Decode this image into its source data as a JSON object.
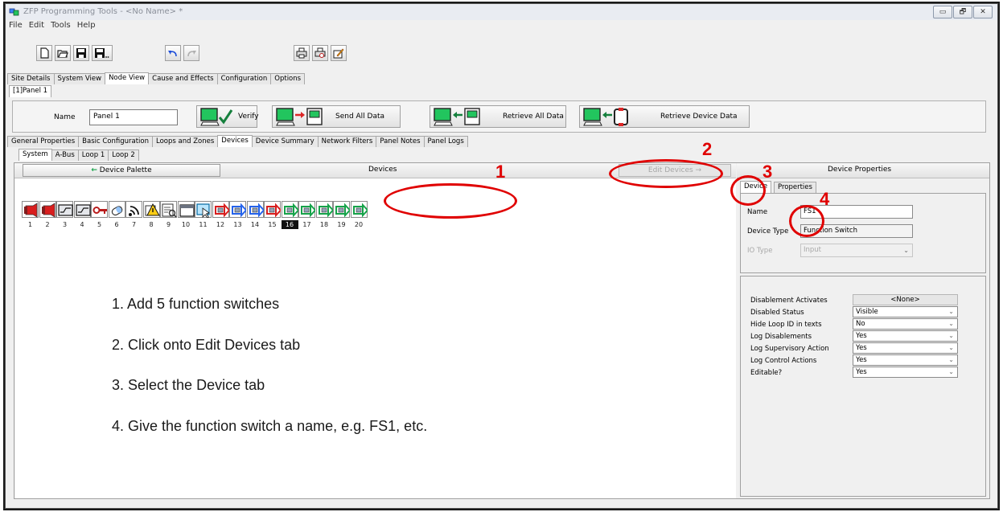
{
  "window": {
    "title": "ZFP Programming Tools - <No Name> *",
    "controls": [
      "▭",
      "🗗",
      "✕"
    ]
  },
  "menu": [
    "File",
    "Edit",
    "Tools",
    "Help"
  ],
  "toolbar_icons": [
    "new-icon",
    "open-icon",
    "save-icon",
    "save-as-icon",
    "undo-icon",
    "redo-icon",
    "print-icon",
    "print-preview-icon",
    "edit-document-icon"
  ],
  "main_tabs": [
    "Site Details",
    "System View",
    "Node View",
    "Cause and Effects",
    "Configuration",
    "Options"
  ],
  "main_tabs_active": "Node View",
  "panel_tab": "[1]Panel 1",
  "panel": {
    "name_label": "Name",
    "name_value": "Panel 1",
    "buttons": [
      "Verify",
      "Send All Data",
      "Retrieve All Data",
      "Retrieve Device Data"
    ]
  },
  "node_tabs": [
    "General Properties",
    "Basic Configuration",
    "Loops and Zones",
    "Devices",
    "Device Summary",
    "Network Filters",
    "Panel Notes",
    "Panel Logs"
  ],
  "node_tabs_active": "Devices",
  "loop_tabs": [
    "System",
    "A-Bus",
    "Loop 1",
    "Loop 2"
  ],
  "loop_tabs_active": "System",
  "devices_header": {
    "palette_label": "Device Palette",
    "center_label": "Devices",
    "edit_label": "Edit Devices",
    "props_label": "Device Properties"
  },
  "devices": [
    {
      "num": "1",
      "kind": "sounder"
    },
    {
      "num": "2",
      "kind": "sounder"
    },
    {
      "num": "3",
      "kind": "relay"
    },
    {
      "num": "4",
      "kind": "relay"
    },
    {
      "num": "5",
      "kind": "key"
    },
    {
      "num": "6",
      "kind": "input"
    },
    {
      "num": "7",
      "kind": "wireless"
    },
    {
      "num": "8",
      "kind": "warning"
    },
    {
      "num": "9",
      "kind": "report"
    },
    {
      "num": "10",
      "kind": "display"
    },
    {
      "num": "11",
      "kind": "pointer"
    },
    {
      "num": "12",
      "kind": "switch-red"
    },
    {
      "num": "13",
      "kind": "switch-blue"
    },
    {
      "num": "14",
      "kind": "switch-blue"
    },
    {
      "num": "15",
      "kind": "switch-red"
    },
    {
      "num": "16",
      "kind": "switch-green"
    },
    {
      "num": "17",
      "kind": "switch-green"
    },
    {
      "num": "18",
      "kind": "switch-green"
    },
    {
      "num": "19",
      "kind": "switch-green"
    },
    {
      "num": "20",
      "kind": "switch-green"
    }
  ],
  "selected_device": "16",
  "colors": {
    "annotation_red": "#e00000",
    "device_red": "#d81e1e",
    "screen_green": "#22c55e"
  },
  "instructions": [
    "1.   Add 5 function switches",
    "2.   Click onto Edit Devices tab",
    "3.   Select the Device tab",
    "4.   Give the function switch a name, e.g. FS1, etc."
  ],
  "annotations": [
    "1",
    "2",
    "3",
    "4"
  ],
  "props": {
    "tabs": [
      "Device",
      "Properties"
    ],
    "active_tab": "Device",
    "name_label": "Name",
    "name_value": "FS1",
    "type_label": "Device Type",
    "type_value": "Function Switch",
    "io_label": "IO Type",
    "io_value": "Input",
    "rows": [
      {
        "label": "Disablement Activates",
        "value": "<None>"
      },
      {
        "label": "Disabled Status",
        "value": "Visible"
      },
      {
        "label": "Hide Loop ID in texts",
        "value": "No"
      },
      {
        "label": "Log Disablements",
        "value": "Yes"
      },
      {
        "label": "Log Supervisory Action",
        "value": "Yes"
      },
      {
        "label": "Log Control Actions",
        "value": "Yes"
      },
      {
        "label": "Editable?",
        "value": "Yes"
      }
    ]
  }
}
